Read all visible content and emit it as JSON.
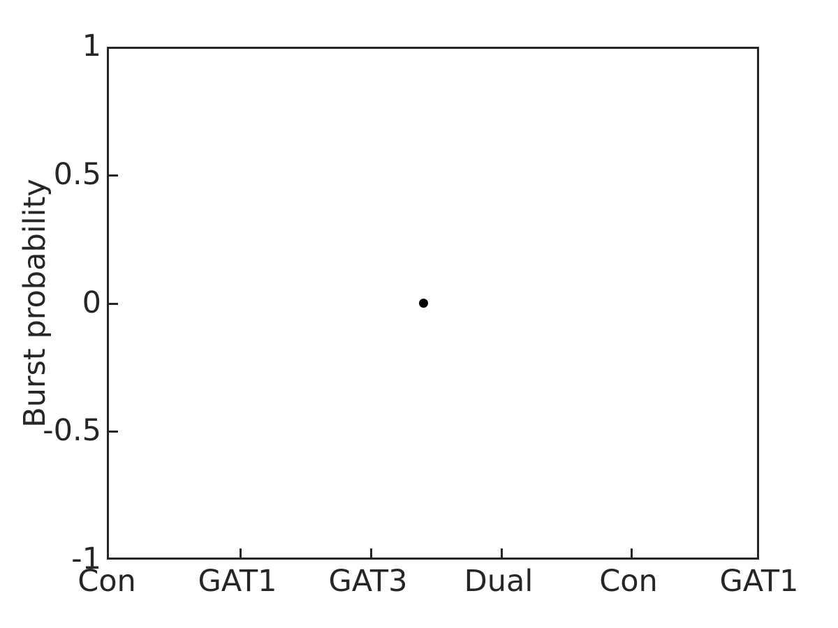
{
  "figure": {
    "background_color": "#ffffff",
    "axes_color": "#262626",
    "marker_color": "#000000"
  },
  "chart_data": {
    "type": "scatter",
    "title": "",
    "xlabel": "",
    "ylabel": "Burst probability",
    "ylim": [
      -1,
      1
    ],
    "yticks": [
      -1,
      -0.5,
      0,
      0.5,
      1
    ],
    "ytick_labels": [
      "-1",
      "-0.5",
      "0",
      "0.5",
      "1"
    ],
    "xlim": [
      0.5,
      6.5
    ],
    "xticks": [
      1,
      2,
      3,
      4,
      5,
      6
    ],
    "categories": [
      "Con",
      "GAT1",
      "GAT3",
      "Dual",
      "Con",
      "GAT1"
    ],
    "grid": false,
    "legend": null,
    "series": [
      {
        "name": "Burst probability",
        "marker": "filled-circle",
        "color": "#000000",
        "points": [
          {
            "x": 3.4,
            "y": 0
          }
        ]
      }
    ]
  }
}
